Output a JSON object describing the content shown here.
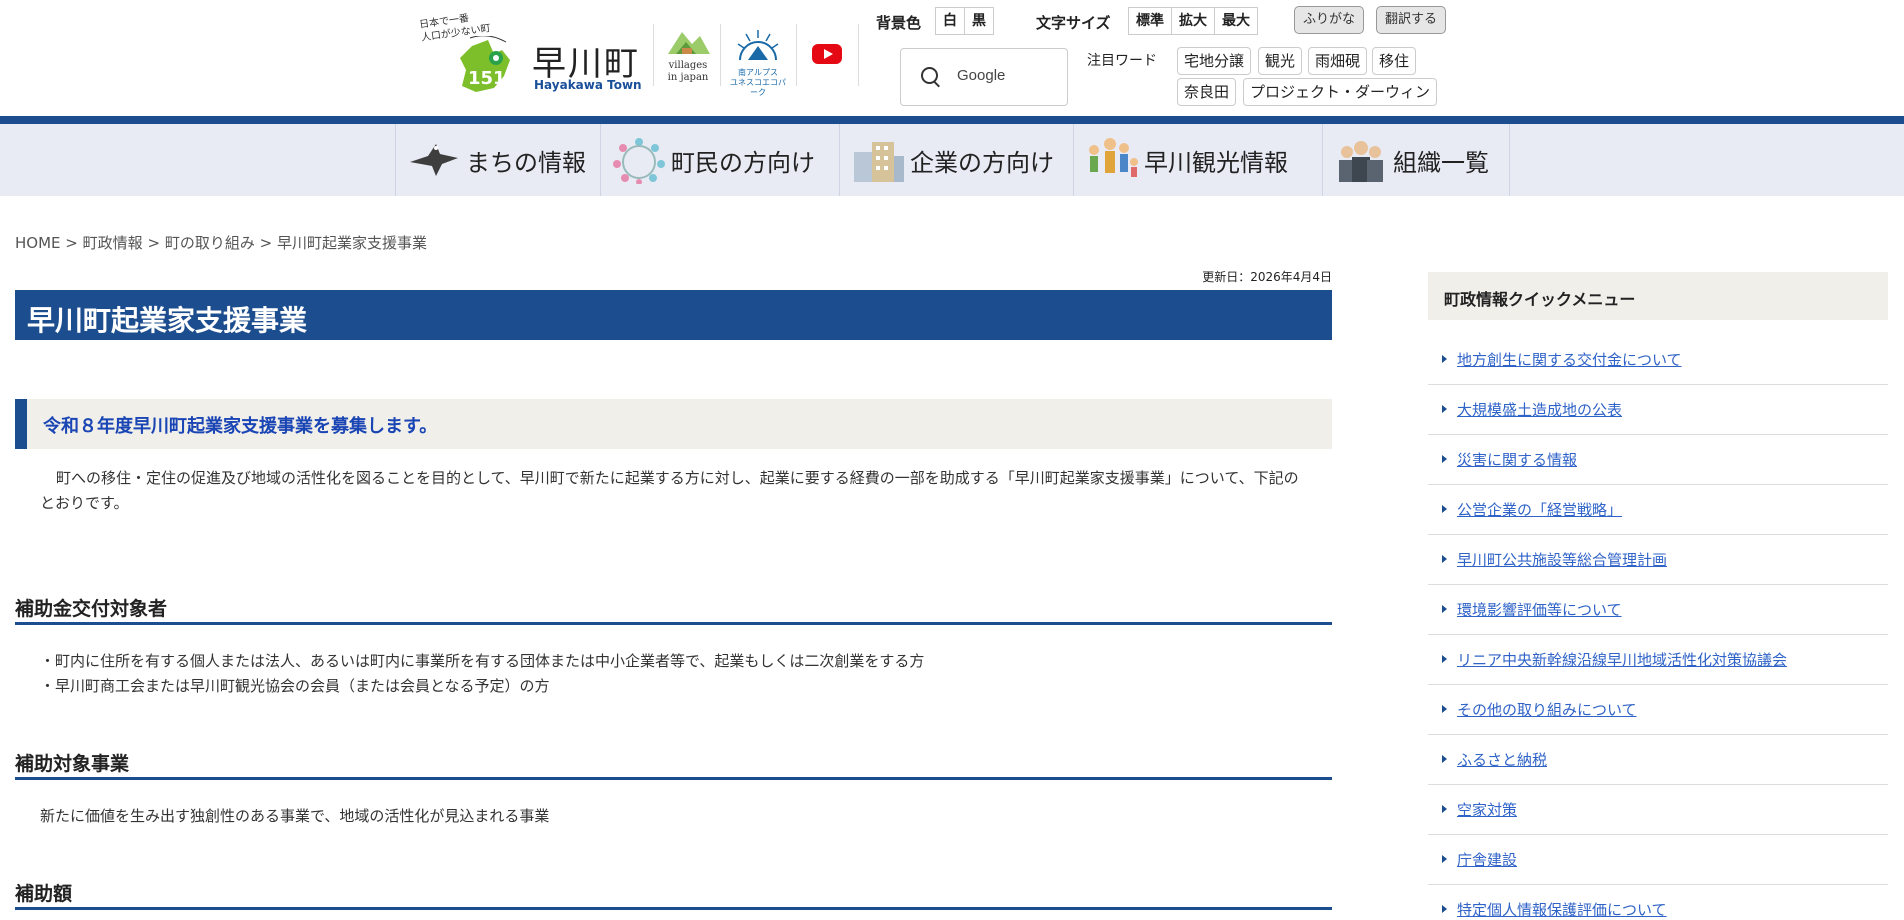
{
  "header": {
    "tagline": "日本で一番\n人口が少ない町",
    "site_name": "早川町",
    "site_name_en": "Hayakawa Town",
    "villages_text": "villages\nin japan",
    "eco_text": "南アルプス\nユネスコエコパーク",
    "bg_color_label": "背景色",
    "bg_white": "白",
    "bg_black": "黒",
    "font_size_label": "文字サイズ",
    "font_standard": "標準",
    "font_large": "拡大",
    "font_max": "最大",
    "furigana": "ふりがな",
    "translate": "翻訳する",
    "search_placeholder": "Google",
    "keywords_label": "注目ワード",
    "keywords": [
      "宅地分譲",
      "観光",
      "雨畑硯",
      "移住",
      "奈良田",
      "プロジェクト・ダーウィン"
    ]
  },
  "nav": [
    {
      "label": "まちの情報",
      "icon": "bird-icon"
    },
    {
      "label": "町民の方向け",
      "icon": "people-circle-icon"
    },
    {
      "label": "企業の方向け",
      "icon": "building-icon"
    },
    {
      "label": "早川観光情報",
      "icon": "family-icon"
    },
    {
      "label": "組織一覧",
      "icon": "staff-icon"
    }
  ],
  "breadcrumb": [
    "HOME",
    "町政情報",
    "町の取り組み",
    "早川町起業家支援事業"
  ],
  "breadcrumb_sep": ">",
  "updated": "更新日：2026年4月4日",
  "page_title": "早川町起業家支援事業",
  "section_heading": "令和８年度早川町起業家支援事業を募集します。",
  "intro": "町への移住・定住の促進及び地域の活性化を図ることを目的として、早川町で新たに起業する方に対し、起業に要する経費の一部を助成する「早川町起業家支援事業」について、下記のとおりです。",
  "sections": [
    {
      "heading": "補助金交付対象者",
      "lines": [
        "・町内に住所を有する個人または法人、あるいは町内に事業所を有する団体または中小企業者等で、起業もしくは二次創業をする方",
        "・早川町商工会または早川町観光協会の会員（または会員となる予定）の方"
      ]
    },
    {
      "heading": "補助対象事業",
      "lines": [
        "新たに価値を生み出す独創性のある事業で、地域の活性化が見込まれる事業"
      ]
    },
    {
      "heading": "補助額",
      "lines": []
    }
  ],
  "sidebar": {
    "heading": "町政情報クイックメニュー",
    "items": [
      "地方創生に関する交付金について",
      "大規模盛土造成地の公表",
      "災害に関する情報",
      "公営企業の「経営戦略」",
      "早川町公共施設等総合管理計画",
      "環境影響評価等について",
      "リニア中央新幹線沿線早川地域活性化対策協議会",
      "その他の取り組みについて",
      "ふるさと納税",
      "空家対策",
      "庁舎建設",
      "特定個人情報保護評価について"
    ]
  },
  "colors": {
    "brand_blue": "#1c4d8e",
    "link_blue": "#2f63c8",
    "nav_bg": "#e8ebf4",
    "heading_bg": "#f1efea",
    "youtube_red": "#e50914",
    "logo_green": "#7dbf2a"
  }
}
